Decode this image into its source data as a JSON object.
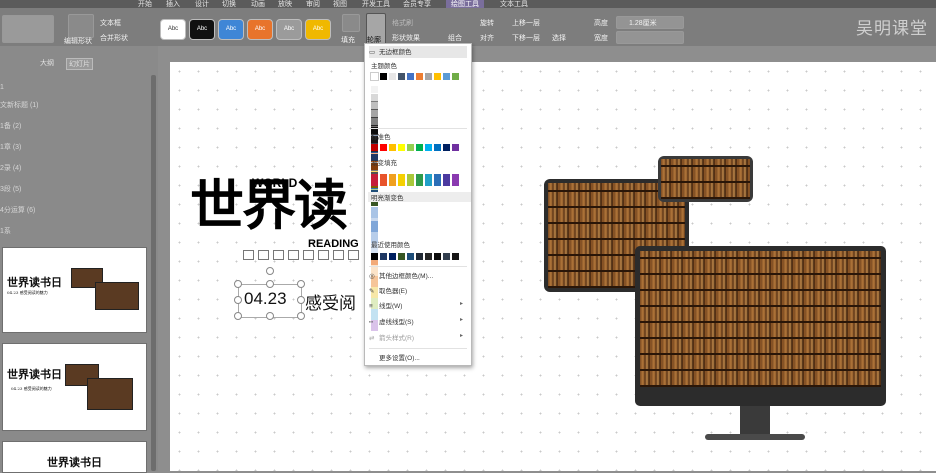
{
  "menu": {
    "items": [
      "开始",
      "插入",
      "设计",
      "切换",
      "动画",
      "放映",
      "审阅",
      "视图",
      "开发工具",
      "会员专享",
      "绘图工具",
      "文本工具"
    ],
    "active": "绘图工具"
  },
  "ribbon": {
    "text_box": "文本框",
    "merge_shape": "合并形状",
    "edit_shape": "编辑形状",
    "style_swatches": [
      {
        "label": "Abc",
        "color": "#ffffff",
        "text": "#333333"
      },
      {
        "label": "Abc",
        "color": "#111111",
        "text": "#ffffff"
      },
      {
        "label": "Abc",
        "color": "#3f86d6",
        "text": "#ffffff"
      },
      {
        "label": "Abc",
        "color": "#e8742b",
        "text": "#ffffff"
      },
      {
        "label": "Abc",
        "color": "#9b9b9b",
        "text": "#ffffff"
      },
      {
        "label": "Abc",
        "color": "#f0b800",
        "text": "#ffffff"
      }
    ],
    "fill": "填充",
    "outline": "轮廓",
    "shape_effects": "形状效果",
    "format_brush": "格式刷",
    "rotate": "旋转",
    "align": "对齐",
    "group": "组合",
    "bring_forward": "上移一层",
    "send_backward": "下移一层",
    "select": "选择",
    "height_label": "高度",
    "height_value": "1.28厘米",
    "width_label": "宽度"
  },
  "brand": "吴明课堂",
  "left_panel": {
    "tabs": [
      "大纲",
      "幻灯片"
    ],
    "outline_items": [
      "1",
      "文新标题 (1)",
      "1备 (2)",
      "1章 (3)",
      "2录 (4)",
      "3段 (5)",
      "4分运算 (6)",
      "1系"
    ]
  },
  "thumbs": [
    {
      "title": "世界读书日",
      "subtitle": "04.23 感受阅读的魅力"
    },
    {
      "title": "世界读书日",
      "subtitle": "04.23 感受阅读的魅力"
    },
    {
      "title": "世界读书日"
    }
  ],
  "slide": {
    "title": "世界读",
    "world": "WORLD",
    "reading": "READING",
    "date": "04.23",
    "subtitle": "感受阅"
  },
  "outline_menu": {
    "no_outline": "无边框颜色",
    "theme_colors": "主题颜色",
    "standard_colors": "标准色",
    "gradient_fill": "渐变填充",
    "bright_gradient": "明亮渐变色",
    "recent_colors": "最近使用颜色",
    "other_colors": "其他边框颜色(M)...",
    "eyedropper": "取色器(E)",
    "line_weight": "线型(W)",
    "dash_type": "虚线线型(S)",
    "arrow_style": "箭头样式(R)",
    "more_settings": "更多设置(O)...",
    "theme_top": [
      "#ffffff",
      "#000000",
      "#e7e6e6",
      "#44546a",
      "#4472c4",
      "#ed7d31",
      "#a5a5a5",
      "#ffc000",
      "#5b9bd5",
      "#70ad47"
    ],
    "theme_cols": [
      [
        "#f2f2f2",
        "#d8d8d8",
        "#bfbfbf",
        "#a5a5a5",
        "#7f7f7f"
      ],
      [
        "#7f7f7f",
        "#595959",
        "#3f3f3f",
        "#262626",
        "#0c0c0c"
      ],
      [
        "#d0cece",
        "#aeabab",
        "#757171",
        "#3a3838",
        "#171616"
      ],
      [
        "#d6dce4",
        "#adb9ca",
        "#8496b0",
        "#333f4f",
        "#222a35"
      ],
      [
        "#d9e2f3",
        "#b4c6e7",
        "#8eaadb",
        "#2f5496",
        "#1f3864"
      ],
      [
        "#fbe5d5",
        "#f7cbac",
        "#f4b183",
        "#c55a11",
        "#833c0b"
      ],
      [
        "#ededed",
        "#dbdbdb",
        "#c9c9c9",
        "#7b7b7b",
        "#525252"
      ],
      [
        "#fff2cc",
        "#fee599",
        "#ffd965",
        "#bf9000",
        "#7f6000"
      ],
      [
        "#deebf6",
        "#bdd7ee",
        "#9cc3e5",
        "#2e75b5",
        "#1e4e79"
      ],
      [
        "#e2efd9",
        "#c5e0b3",
        "#a8d08d",
        "#538135",
        "#375623"
      ]
    ],
    "standard": [
      "#c00000",
      "#ff0000",
      "#ffc000",
      "#ffff00",
      "#92d050",
      "#00b050",
      "#00b0f0",
      "#0070c0",
      "#002060",
      "#7030a0"
    ],
    "gradient": [
      "#c41e3a",
      "#e8542b",
      "#f0a020",
      "#f5d000",
      "#a8c83a",
      "#2e9a4c",
      "#21a0c8",
      "#2b6fb8",
      "#4b3aa0",
      "#8a3ab0"
    ],
    "bright": [
      [
        "#a9c4e6",
        "#c8d8ee",
        "#8fb0dc",
        "#f4c29a",
        "#f7d8b8",
        "#f6b07a",
        "#f1dd8a",
        "#c9df9c",
        "#a9d2e9",
        "#c6a9dc"
      ],
      [
        "#7fa6d8",
        "#b7cdea",
        "#d6e3f3",
        "#f2a977",
        "#fbe3c9",
        "#f6c59a",
        "#f7e7a7",
        "#dfedc1",
        "#c3e2f2",
        "#dac3ea"
      ]
    ],
    "recent": [
      "#000000",
      "#1f3864",
      "#002060",
      "#375623",
      "#1e4e79",
      "#222a35",
      "#262626",
      "#0c0c0c",
      "#333f4f",
      "#171616"
    ]
  }
}
